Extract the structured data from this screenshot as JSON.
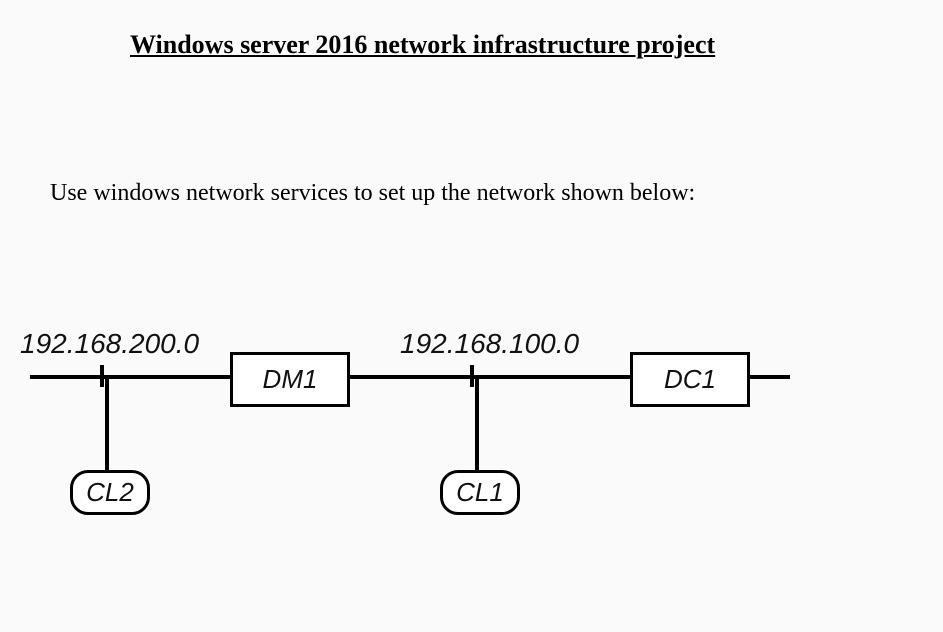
{
  "title": "Windows server 2016  network infrastructure project",
  "instruction": "Use windows network services to set up the network shown below:",
  "diagram": {
    "subnet_left": "192.168.200.0",
    "subnet_right": "192.168.100.0",
    "nodes": {
      "dm1": "DM1",
      "dc1": "DC1",
      "cl1": "CL1",
      "cl2": "CL2"
    }
  }
}
